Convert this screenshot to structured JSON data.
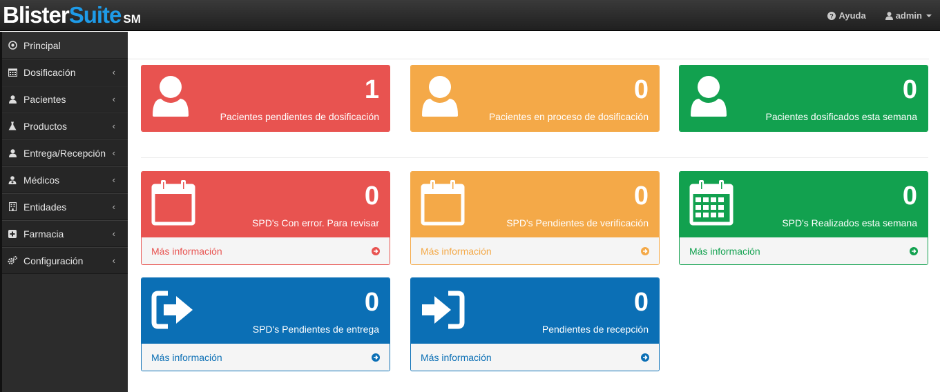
{
  "brand": {
    "part1": "Blister",
    "part2": "Suite",
    "part3": "SM"
  },
  "navbar": {
    "help_label": "Ayuda",
    "help_icon": "question-circle-icon",
    "user_label": "admin",
    "user_icon": "user-icon"
  },
  "sidebar": {
    "items": [
      {
        "label": "Principal",
        "icon": "target-icon",
        "has_chevron": false
      },
      {
        "label": "Dosificación",
        "icon": "calendar-icon",
        "has_chevron": true
      },
      {
        "label": "Pacientes",
        "icon": "user-icon",
        "has_chevron": true
      },
      {
        "label": "Productos",
        "icon": "flask-icon",
        "has_chevron": true
      },
      {
        "label": "Entrega/Recepción",
        "icon": "user-icon",
        "has_chevron": true
      },
      {
        "label": "Médicos",
        "icon": "doctor-icon",
        "has_chevron": true
      },
      {
        "label": "Entidades",
        "icon": "building-icon",
        "has_chevron": true
      },
      {
        "label": "Farmacia",
        "icon": "plus-square-icon",
        "has_chevron": true
      },
      {
        "label": "Configuración",
        "icon": "gears-icon",
        "has_chevron": true
      }
    ],
    "chevron": "‹"
  },
  "boxes": {
    "pending_dosing": {
      "value": "1",
      "label": "Pacientes pendientes de dosificación"
    },
    "in_process_dosing": {
      "value": "0",
      "label": "Pacientes en proceso de dosificación"
    },
    "dosed_week": {
      "value": "0",
      "label": "Pacientes dosificados esta semana"
    },
    "spd_error": {
      "value": "0",
      "label": "SPD's Con error. Para revisar",
      "more": "Más información"
    },
    "spd_verify": {
      "value": "0",
      "label": "SPD's Pendientes de verificación",
      "more": "Más información"
    },
    "spd_done": {
      "value": "0",
      "label": "SPD's Realizados esta semana",
      "more": "Más información"
    },
    "spd_delivery": {
      "value": "0",
      "label": "SPD's Pendientes de entrega",
      "more": "Más información"
    },
    "reception": {
      "value": "0",
      "label": "Pendientes de recepción",
      "more": "Más información"
    }
  },
  "colors": {
    "red": "#e85350",
    "orange": "#f4a948",
    "green": "#12a14f",
    "blue": "#0b6fb5",
    "brand_accent": "#1e9be8"
  }
}
